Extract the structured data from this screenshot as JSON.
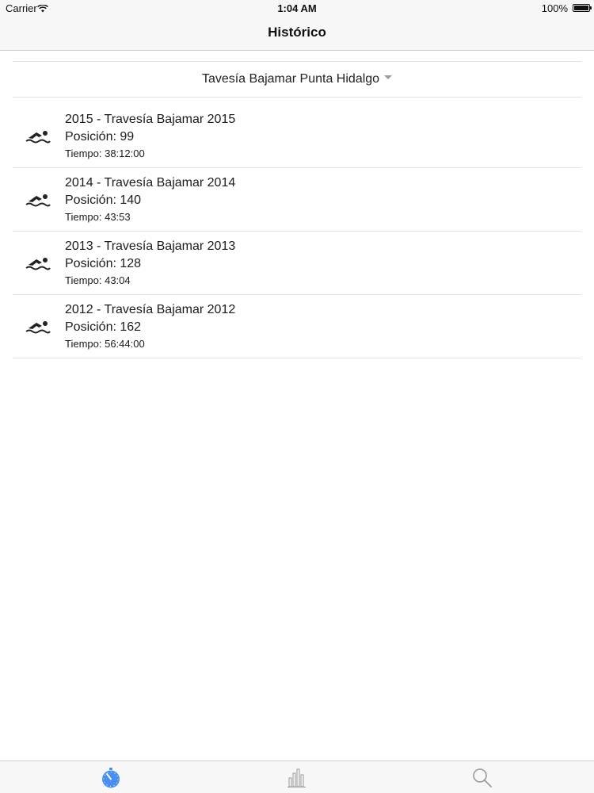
{
  "status_bar": {
    "carrier": "Carrier",
    "time": "1:04 AM",
    "battery": "100%"
  },
  "nav": {
    "title": "Histórico"
  },
  "selector": {
    "label": "Tavesía Bajamar Punta Hidalgo"
  },
  "results": [
    {
      "title": "2015 - Travesía Bajamar 2015",
      "position": "Posición: 99",
      "time": "Tiempo: 38:12:00"
    },
    {
      "title": "2014 - Travesía Bajamar 2014",
      "position": "Posición: 140",
      "time": "Tiempo: 43:53"
    },
    {
      "title": "2013 - Travesía Bajamar 2013",
      "position": "Posición: 128",
      "time": "Tiempo: 43:04"
    },
    {
      "title": "2012 - Travesía Bajamar 2012",
      "position": "Posición: 162",
      "time": "Tiempo: 56:44:00"
    }
  ],
  "tab_bar": {
    "tabs": [
      {
        "icon": "stopwatch-icon",
        "active": true
      },
      {
        "icon": "bar-chart-icon",
        "active": false
      },
      {
        "icon": "search-icon",
        "active": false
      }
    ],
    "active_color": "#4a8ff0",
    "inactive_color": "#9a9a9a"
  }
}
